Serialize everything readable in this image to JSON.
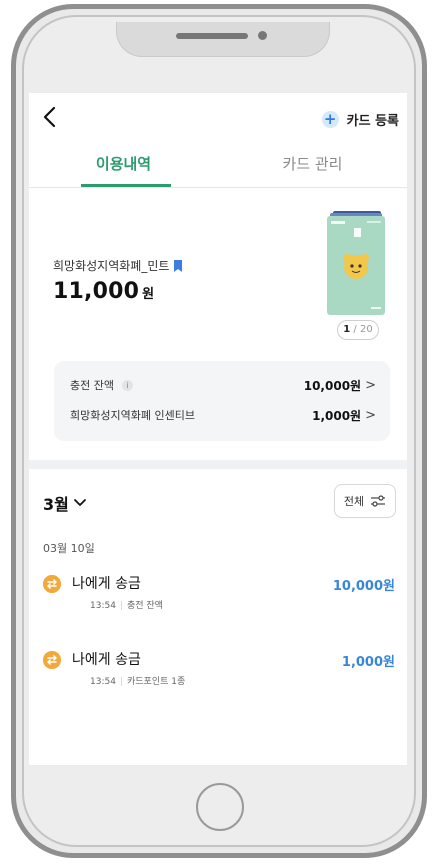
{
  "header": {
    "register_label": "카드 등록",
    "plus": "+"
  },
  "tabs": [
    {
      "label": "이용내역",
      "active": true
    },
    {
      "label": "카드 관리",
      "active": false
    }
  ],
  "card": {
    "name": "희망화성지역화폐_민트",
    "balance": "11,000",
    "balance_unit": "원",
    "page_current": "1",
    "page_separator": "/",
    "page_total": "20"
  },
  "info": {
    "charge_label": "충전 잔액",
    "charge_info_icon": "i",
    "charge_value": "10,000원",
    "incentive_label": "희망화성지역화폐 인센티브",
    "incentive_value": "1,000원",
    "chevron": ">"
  },
  "history": {
    "month": "3월",
    "filter_label": "전체",
    "date": "03월 10일",
    "transactions": [
      {
        "title": "나에게 송금",
        "time": "13:54",
        "detail": "충전 잔액",
        "amount": "10,000원"
      },
      {
        "title": "나에게 송금",
        "time": "13:54",
        "detail": "카드포인트 1종",
        "amount": "1,000원"
      }
    ]
  },
  "colors": {
    "accent_green": "#2e9b6f",
    "amount_blue": "#3a86d6",
    "tx_icon_orange": "#f2a93b",
    "card_mint": "#a9d8c3"
  },
  "icons": {
    "back": "chevron-left-icon",
    "bookmark": "bookmark-icon",
    "filter": "sliders-icon",
    "transfer": "transfer-icon"
  }
}
